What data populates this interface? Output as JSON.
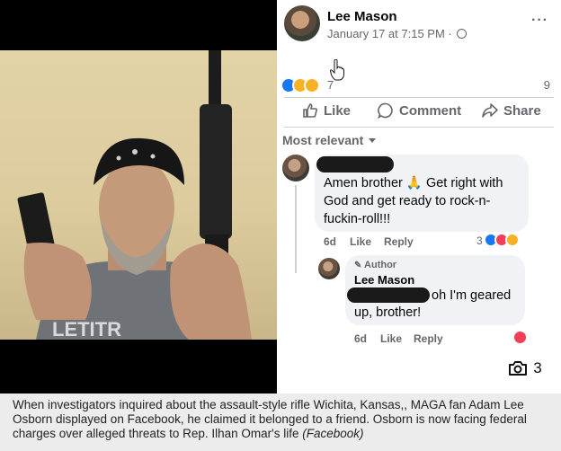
{
  "post": {
    "author": "Lee Mason",
    "date": "January 17 at 7:15 PM · ",
    "more": "···",
    "reaction_count": "7",
    "comment_count": "9",
    "actions": {
      "like": "Like",
      "comment": "Comment",
      "share": "Share"
    },
    "sort": "Most relevant"
  },
  "comments": [
    {
      "text": "Amen brother 🙏 Get right with God and get ready to rock-n-fuckin-roll!!!",
      "time": "6d",
      "like": "Like",
      "reply": "Reply",
      "reaction_count": "3"
    }
  ],
  "reply": {
    "badge": "Author",
    "author": "Lee Mason",
    "text_part1": "oh I'm geared",
    "text_part2": "up, brother!",
    "time": "6d",
    "like": "Like",
    "reply": "Reply"
  },
  "photo_count": "3",
  "caption": {
    "text": "When investigators inquired about the assault-style rifle Wichita, Kansas,, MAGA fan Adam Lee Osborn displayed on Facebook, he claimed it belonged to a friend. Osborn is now facing federal charges over alleged threats to Rep. Ilhan Omar's life ",
    "source": "(Facebook)"
  },
  "colors": {
    "fb_blue": "#1877f2",
    "meta_gray": "#65676b",
    "bubble": "#f0f2f5",
    "love": "#f33e58"
  }
}
